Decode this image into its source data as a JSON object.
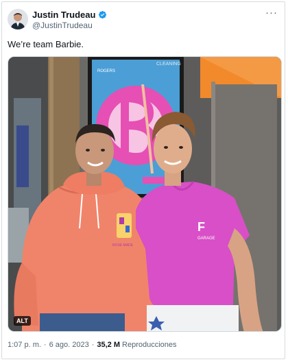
{
  "author": {
    "name": "Justin Trudeau",
    "handle": "@JustinTrudeau"
  },
  "tweet": {
    "text": "We’re team Barbie."
  },
  "media": {
    "poster_sign": "CLEANING",
    "poster_brand": "ROGERS",
    "shirt_text": "GARAGE",
    "sweatshirt_text": "ROSE MADE",
    "alt_label": "ALT"
  },
  "meta": {
    "time": "1:07 p. m.",
    "dot": "·",
    "date": "6 ago. 2023",
    "views_count": "35,2 M",
    "views_label": "Reproducciones"
  },
  "colors": {
    "verified": "#1d9bf0",
    "text_primary": "#0f1419",
    "text_secondary": "#536471",
    "sweatshirt": "#f0846a",
    "pink_shirt": "#d84fc7",
    "orange_wall": "#f28a2c"
  }
}
